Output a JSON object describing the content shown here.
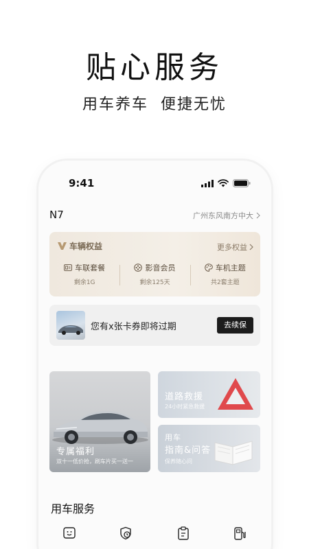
{
  "hero": {
    "title": "贴心服务",
    "subtitle": "用车养车  便捷无忧"
  },
  "status_bar": {
    "time": "9:41"
  },
  "car": {
    "model": "N7",
    "dealer": "广州东风南方中大"
  },
  "benefits": {
    "title": "车辆权益",
    "more": "更多权益",
    "items": [
      {
        "label": "车联套餐",
        "value": "剩余1G",
        "icon": "sim-icon"
      },
      {
        "label": "影音会员",
        "value": "剩余125天",
        "icon": "media-icon"
      },
      {
        "label": "车机主题",
        "value": "共2套主题",
        "icon": "palette-icon"
      }
    ]
  },
  "coupon": {
    "text": "您有x张卡券即将过期",
    "button": "去续保"
  },
  "cards": {
    "welfare": {
      "title": "专属福利",
      "desc": "双十一低价抢，刷车片买一送一"
    },
    "rescue": {
      "title": "道路救援",
      "desc": "24小时紧急救援"
    },
    "guide": {
      "title_line1": "用车",
      "title_line2": "指南&问答",
      "desc": "保养随心问"
    }
  },
  "services": {
    "title": "用车服务",
    "icons": [
      "smile-face-icon",
      "shield-clock-icon",
      "clipboard-icon",
      "fuel-pump-icon"
    ]
  },
  "colors": {
    "accent_gold": "#7a6a55",
    "dark_button": "#1c1c1c",
    "warning_red": "#e0494c"
  }
}
